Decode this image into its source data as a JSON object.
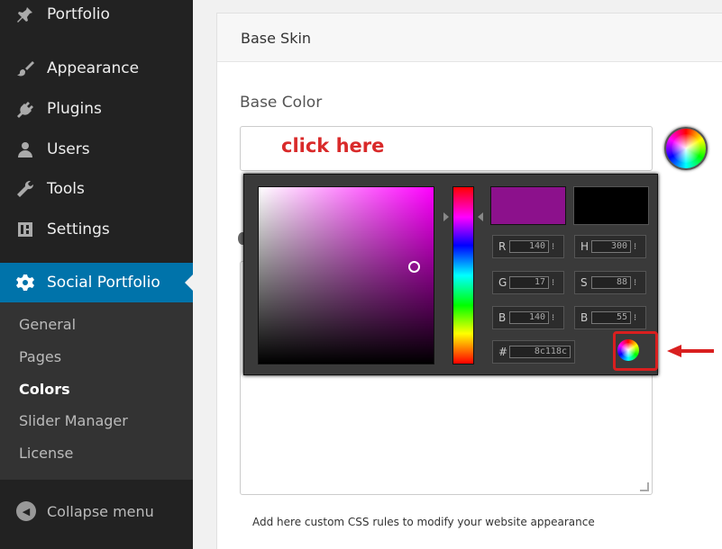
{
  "sidebar": {
    "items": [
      {
        "label": "Portfolio",
        "icon": "pin-icon"
      },
      {
        "label": "Appearance",
        "icon": "brush-icon"
      },
      {
        "label": "Plugins",
        "icon": "plug-icon"
      },
      {
        "label": "Users",
        "icon": "user-icon"
      },
      {
        "label": "Tools",
        "icon": "wrench-icon"
      },
      {
        "label": "Settings",
        "icon": "settings-icon"
      },
      {
        "label": "Social Portfolio",
        "icon": "gear-icon"
      }
    ],
    "submenu": [
      "General",
      "Pages",
      "Colors",
      "Slider Manager",
      "License"
    ],
    "collapse_label": "Collapse menu"
  },
  "main": {
    "section_title": "Base Skin",
    "field_label": "Base Color",
    "annotation": "click here",
    "help_text": "Add here custom CSS rules to modify your website appearance"
  },
  "picker": {
    "r": "140",
    "g": "17",
    "b": "140",
    "h": "300",
    "s": "88",
    "bv": "55",
    "hex": "8c118c",
    "new_color": "#8c118c",
    "current_color": "#000000"
  },
  "colors": {
    "sidebar_bg": "#222222",
    "active_bg": "#0073aa",
    "annotation_red": "#d92a2a"
  }
}
